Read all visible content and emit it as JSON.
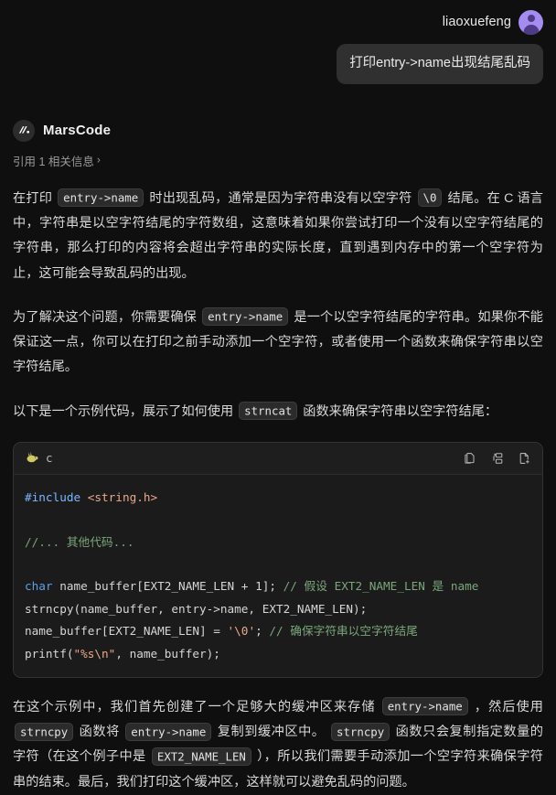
{
  "user": {
    "name": "liaoxuefeng",
    "avatar_icon": "user-avatar-icon",
    "message": "打印entry->name出现结尾乱码"
  },
  "assistant": {
    "name": "MarsCode",
    "logo_icon": "marscode-logo-icon",
    "citation": {
      "label": "引用 1 相关信息",
      "chevron": "›"
    },
    "paragraphs": [
      {
        "parts": [
          {
            "type": "text",
            "value": "在打印 "
          },
          {
            "type": "code",
            "value": "entry->name"
          },
          {
            "type": "text",
            "value": " 时出现乱码，通常是因为字符串没有以空字符 "
          },
          {
            "type": "code",
            "value": "\\0"
          },
          {
            "type": "text",
            "value": " 结尾。在 C 语言中，字符串是以空字符结尾的字符数组，这意味着如果你尝试打印一个没有以空字符结尾的字符串，那么打印的内容将会超出字符串的实际长度，直到遇到内存中的第一个空字符为止，这可能会导致乱码的出现。"
          }
        ]
      },
      {
        "parts": [
          {
            "type": "text",
            "value": "为了解决这个问题，你需要确保 "
          },
          {
            "type": "code",
            "value": "entry->name"
          },
          {
            "type": "text",
            "value": " 是一个以空字符结尾的字符串。如果你不能保证这一点，你可以在打印之前手动添加一个空字符，或者使用一个函数来确保字符串以空字符结尾。"
          }
        ]
      },
      {
        "parts": [
          {
            "type": "text",
            "value": "以下是一个示例代码，展示了如何使用 "
          },
          {
            "type": "code",
            "value": "strncat"
          },
          {
            "type": "text",
            "value": " 函数来确保字符串以空字符结尾："
          }
        ]
      }
    ],
    "closing_paragraph": {
      "parts": [
        {
          "type": "text",
          "value": "在这个示例中，我们首先创建了一个足够大的缓冲区来存储 "
        },
        {
          "type": "code",
          "value": "entry->name"
        },
        {
          "type": "text",
          "value": " ，然后使用 "
        },
        {
          "type": "code",
          "value": "strncpy"
        },
        {
          "type": "text",
          "value": " 函数将 "
        },
        {
          "type": "code",
          "value": "entry->name"
        },
        {
          "type": "text",
          "value": " 复制到缓冲区中。 "
        },
        {
          "type": "code",
          "value": "strncpy"
        },
        {
          "type": "text",
          "value": " 函数只会复制指定数量的字符（在这个例子中是 "
        },
        {
          "type": "code",
          "value": "EXT2_NAME_LEN"
        },
        {
          "type": "text",
          "value": " ），所以我们需要手动添加一个空字符来确保字符串的结束。最后，我们打印这个缓冲区，这样就可以避免乱码的问题。"
        }
      ]
    }
  },
  "codeblock": {
    "language_label": "c",
    "language_icon": "rabbit-icon",
    "actions": [
      {
        "name": "copy-code-icon",
        "title": "Copy"
      },
      {
        "name": "insert-diff-icon",
        "title": "Insert"
      },
      {
        "name": "new-file-icon",
        "title": "New file"
      }
    ],
    "lines": [
      [
        {
          "t": "pre",
          "v": "#include"
        },
        {
          "t": "txt",
          "v": " "
        },
        {
          "t": "str",
          "v": "<string.h>"
        }
      ],
      [
        {
          "t": "txt",
          "v": ""
        }
      ],
      [
        {
          "t": "cmt",
          "v": "//... 其他代码..."
        }
      ],
      [
        {
          "t": "txt",
          "v": ""
        }
      ],
      [
        {
          "t": "kw",
          "v": "char"
        },
        {
          "t": "txt",
          "v": " name_buffer[EXT2_NAME_LEN + 1]; "
        },
        {
          "t": "cmt",
          "v": "// 假设 EXT2_NAME_LEN 是 name"
        }
      ],
      [
        {
          "t": "txt",
          "v": "strncpy(name_buffer, entry->name, EXT2_NAME_LEN);"
        }
      ],
      [
        {
          "t": "txt",
          "v": "name_buffer[EXT2_NAME_LEN] = "
        },
        {
          "t": "str",
          "v": "'\\0'"
        },
        {
          "t": "txt",
          "v": "; "
        },
        {
          "t": "cmt",
          "v": "// 确保字符串以空字符结尾"
        }
      ],
      [
        {
          "t": "txt",
          "v": "printf("
        },
        {
          "t": "str",
          "v": "\"%s\\n\""
        },
        {
          "t": "txt",
          "v": ", name_buffer);"
        }
      ]
    ]
  },
  "colors": {
    "page_bg": "#0f0f0f",
    "bubble_bg": "#303030",
    "avatar_purple": "#a58cf0",
    "code_bg": "#1b1b1b",
    "code_header_bg": "#1e1e1e",
    "chip_bg": "#2b2b2b",
    "rabbit_yellow": "#cfca62",
    "token_preprocessor": "#79b8ff",
    "token_string": "#e8a98b",
    "token_comment": "#79a67a",
    "token_keyword": "#5f9fe0"
  }
}
